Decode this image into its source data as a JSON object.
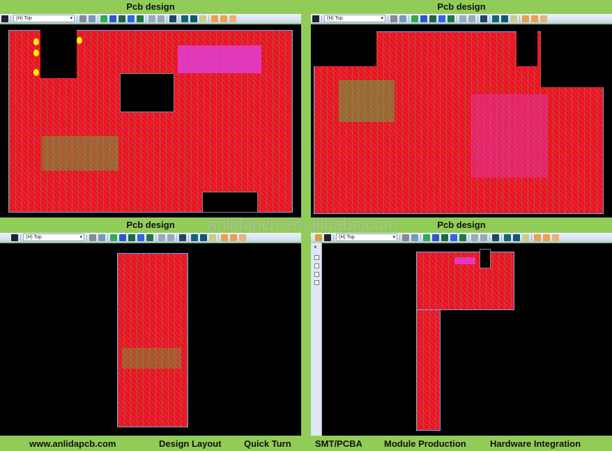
{
  "panels": [
    {
      "title": "Pcb design",
      "layer_select": "(H) Top"
    },
    {
      "title": "Pcb design",
      "layer_select": "(H) Top"
    },
    {
      "title": "Pcb design",
      "layer_select": "(H) Top"
    },
    {
      "title": "Pcb design",
      "layer_select": "(H) Top"
    }
  ],
  "side_panel": {
    "close": "×"
  },
  "watermark": "anlidapcb.en.alibaba.com",
  "bottom": {
    "website": "www.anlidapcb.com",
    "items": [
      "Design Layout",
      "Quick Turn",
      "SMT/PCBA",
      "Module Production",
      "Hardware Integration"
    ]
  },
  "colors": {
    "background": "#92cc58",
    "board": "#e8141b",
    "canvas": "#000000"
  }
}
